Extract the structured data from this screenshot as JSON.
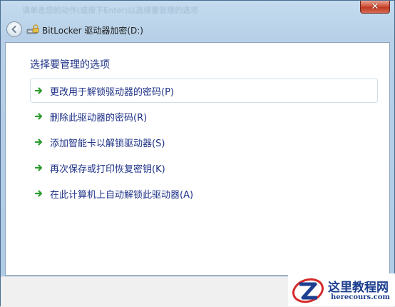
{
  "window": {
    "background_title": "请单击您的动作(或按下Enter)以选择要管理的选项",
    "title": "BitLocker 驱动器加密(D:)",
    "close_glyph": "✕"
  },
  "main": {
    "heading": "选择要管理的选项",
    "options": [
      {
        "label": "更改用于解锁驱动器的密码(P)"
      },
      {
        "label": "删除此驱动器的密码(R)"
      },
      {
        "label": "添加智能卡以解锁驱动器(S)"
      },
      {
        "label": "再次保存或打印恢复密钥(K)"
      },
      {
        "label": "在此计算机上自动解锁此驱动器(A)"
      }
    ]
  },
  "watermark": {
    "text": "这里教程网",
    "subtext": "herecours.com"
  },
  "colors": {
    "link_blue": "#1e3287",
    "arrow_green": "#2c9b2c",
    "close_red": "#c03a22"
  }
}
